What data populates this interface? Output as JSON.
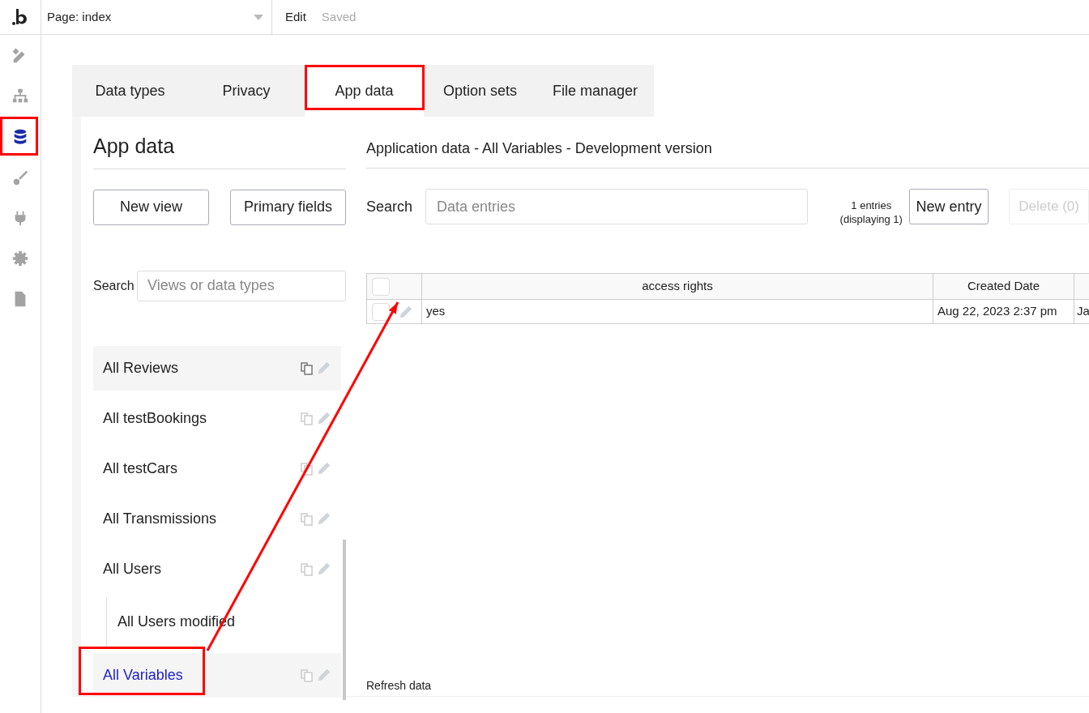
{
  "topbar": {
    "page_selector": "Page: index",
    "edit": "Edit",
    "status": "Saved"
  },
  "sidebar": {
    "items": [
      {
        "selected": false
      },
      {
        "selected": false
      },
      {
        "selected": true
      },
      {
        "selected": false
      },
      {
        "selected": false
      },
      {
        "selected": false
      },
      {
        "selected": false
      }
    ]
  },
  "tabs": [
    {
      "label": "Data types",
      "selected": false
    },
    {
      "label": "Privacy",
      "selected": false
    },
    {
      "label": "App data",
      "selected": true
    },
    {
      "label": "Option sets",
      "selected": false
    },
    {
      "label": "File manager",
      "selected": false
    }
  ],
  "left_panel": {
    "title": "App data",
    "buttons": [
      "New view",
      "Primary fields"
    ],
    "search": {
      "label": "Search",
      "placeholder": "Views or data types"
    },
    "views": [
      {
        "label": "All Reviews",
        "selected": false,
        "hovered": true
      },
      {
        "label": "All testBookings",
        "selected": false,
        "hovered": false
      },
      {
        "label": "All testCars",
        "selected": false,
        "hovered": false
      },
      {
        "label": "All Transmissions",
        "selected": false,
        "hovered": false
      },
      {
        "label": "All Users",
        "selected": false,
        "hovered": false,
        "children": [
          {
            "label": "All Users modified",
            "selected": false
          }
        ]
      },
      {
        "label": "All Variables",
        "selected": true,
        "hovered": false
      }
    ]
  },
  "right_panel": {
    "title": "Application data - All Variables - Development version",
    "search": {
      "label": "Search",
      "placeholder": "Data entries"
    },
    "count": "1 entries (displaying 1)",
    "new_entry": "New entry",
    "delete": {
      "label": "Delete (0)",
      "disabled": true
    },
    "table": {
      "all_checked": false,
      "columns": [
        "access rights",
        "Created Date"
      ],
      "rows": [
        {
          "checked": false,
          "cells": [
            "yes",
            "Aug 22, 2023 2:37 pm",
            "Ja"
          ]
        }
      ]
    },
    "refresh": "Refresh data"
  }
}
